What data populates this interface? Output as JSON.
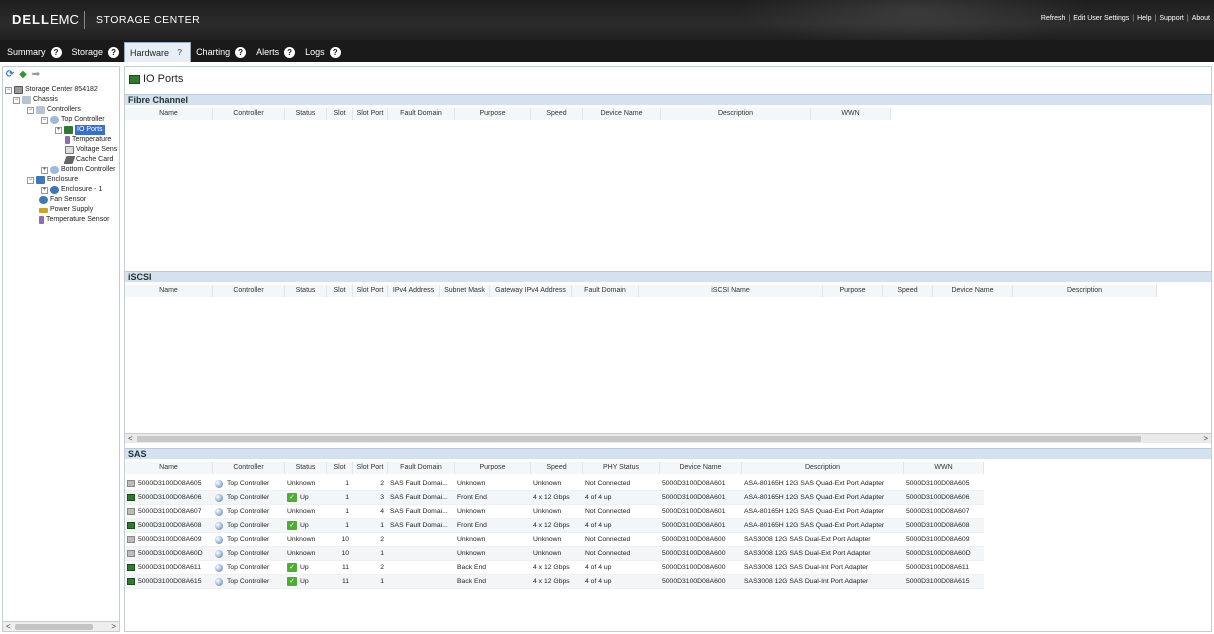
{
  "header": {
    "logo_dell": "DELL",
    "logo_emc": "EMC",
    "product": "STORAGE CENTER",
    "links": [
      "Refresh",
      "Edit User Settings",
      "Help",
      "Support",
      "About"
    ]
  },
  "tabs": [
    {
      "label": "Summary",
      "active": false
    },
    {
      "label": "Storage",
      "active": false
    },
    {
      "label": "Hardware",
      "active": true
    },
    {
      "label": "Charting",
      "active": false
    },
    {
      "label": "Alerts",
      "active": false
    },
    {
      "label": "Logs",
      "active": false
    }
  ],
  "tree": {
    "nodes": [
      {
        "label": "Storage Center 854182",
        "icon": "storage-center-icon"
      },
      {
        "label": "Chassis",
        "icon": "chassis-icon"
      },
      {
        "label": "Controllers",
        "icon": "controllers-icon"
      },
      {
        "label": "Top Controller",
        "icon": "controller-icon"
      },
      {
        "label": "IO Ports",
        "icon": "io-ports-icon",
        "selected": true
      },
      {
        "label": "Temperature",
        "icon": "temperature-icon"
      },
      {
        "label": "Voltage Sens",
        "icon": "voltage-icon"
      },
      {
        "label": "Cache Card",
        "icon": "cache-card-icon"
      },
      {
        "label": "Bottom Controller",
        "icon": "controller-icon"
      },
      {
        "label": "Enclosure",
        "icon": "enclosure-icon"
      },
      {
        "label": "Enclosure - 1",
        "icon": "enclosure-icon"
      },
      {
        "label": "Fan Sensor",
        "icon": "fan-icon"
      },
      {
        "label": "Power Supply",
        "icon": "power-icon"
      },
      {
        "label": "Temperature Sensor",
        "icon": "temperature-icon"
      }
    ]
  },
  "content": {
    "title": "IO Ports",
    "fibre_channel": {
      "title": "Fibre Channel",
      "columns": [
        "Name",
        "Controller",
        "Status",
        "Slot",
        "Slot Port",
        "Fault Domain",
        "Purpose",
        "Speed",
        "Device Name",
        "Description",
        "WWN"
      ]
    },
    "iscsi": {
      "title": "iSCSI",
      "columns": [
        "Name",
        "Controller",
        "Status",
        "Slot",
        "Slot Port",
        "IPv4 Address",
        "Subnet Mask",
        "Gateway IPv4 Address",
        "Fault Domain",
        "iSCSI Name",
        "Purpose",
        "Speed",
        "Device Name",
        "Description"
      ]
    },
    "sas": {
      "title": "SAS",
      "columns": [
        "Name",
        "Controller",
        "Status",
        "Slot",
        "Slot Port",
        "Fault Domain",
        "Purpose",
        "Speed",
        "PHY Status",
        "Device Name",
        "Description",
        "WWN"
      ],
      "rows": [
        {
          "name": "5000D3100D08A605",
          "up": false,
          "controller": "Top Controller",
          "status": "Unknown",
          "slot": "1",
          "slot_port": "2",
          "fault_domain": "SAS Fault Domai...",
          "purpose": "Unknown",
          "speed": "Unknown",
          "phy": "Not Connected",
          "device": "5000D3100D08A601",
          "description": "ASA-80165H 12G SAS Quad-Ext Port Adapter",
          "wwn": "5000D3100D08A605"
        },
        {
          "name": "5000D3100D08A606",
          "up": true,
          "controller": "Top Controller",
          "status": "Up",
          "slot": "1",
          "slot_port": "3",
          "fault_domain": "SAS Fault Domai...",
          "purpose": "Front End",
          "speed": "4 x 12 Gbps",
          "phy": "4 of 4 up",
          "device": "5000D3100D08A601",
          "description": "ASA-80165H 12G SAS Quad-Ext Port Adapter",
          "wwn": "5000D3100D08A606"
        },
        {
          "name": "5000D3100D08A607",
          "up": false,
          "controller": "Top Controller",
          "status": "Unknown",
          "slot": "1",
          "slot_port": "4",
          "fault_domain": "SAS Fault Domai...",
          "purpose": "Unknown",
          "speed": "Unknown",
          "phy": "Not Connected",
          "device": "5000D3100D08A601",
          "description": "ASA-80165H 12G SAS Quad-Ext Port Adapter",
          "wwn": "5000D3100D08A607"
        },
        {
          "name": "5000D3100D08A608",
          "up": true,
          "controller": "Top Controller",
          "status": "Up",
          "slot": "1",
          "slot_port": "1",
          "fault_domain": "SAS Fault Domai...",
          "purpose": "Front End",
          "speed": "4 x 12 Gbps",
          "phy": "4 of 4 up",
          "device": "5000D3100D08A601",
          "description": "ASA-80165H 12G SAS Quad-Ext Port Adapter",
          "wwn": "5000D3100D08A608"
        },
        {
          "name": "5000D3100D08A609",
          "up": false,
          "controller": "Top Controller",
          "status": "Unknown",
          "slot": "10",
          "slot_port": "2",
          "fault_domain": "",
          "purpose": "Unknown",
          "speed": "Unknown",
          "phy": "Not Connected",
          "device": "5000D3100D08A600",
          "description": "SAS3008 12G SAS Dual-Ext Port Adapter",
          "wwn": "5000D3100D08A609"
        },
        {
          "name": "5000D3100D08A60D",
          "up": false,
          "controller": "Top Controller",
          "status": "Unknown",
          "slot": "10",
          "slot_port": "1",
          "fault_domain": "",
          "purpose": "Unknown",
          "speed": "Unknown",
          "phy": "Not Connected",
          "device": "5000D3100D08A600",
          "description": "SAS3008 12G SAS Dual-Ext Port Adapter",
          "wwn": "5000D3100D08A60D"
        },
        {
          "name": "5000D3100D08A611",
          "up": true,
          "controller": "Top Controller",
          "status": "Up",
          "slot": "11",
          "slot_port": "2",
          "fault_domain": "",
          "purpose": "Back End",
          "speed": "4 x 12 Gbps",
          "phy": "4 of 4 up",
          "device": "5000D3100D08A600",
          "description": "SAS3008 12G SAS Dual-Int Port Adapter",
          "wwn": "5000D3100D08A611"
        },
        {
          "name": "5000D3100D08A615",
          "up": true,
          "controller": "Top Controller",
          "status": "Up",
          "slot": "11",
          "slot_port": "1",
          "fault_domain": "",
          "purpose": "Back End",
          "speed": "4 x 12 Gbps",
          "phy": "4 of 4 up",
          "device": "5000D3100D08A600",
          "description": "SAS3008 12G SAS Dual-Int Port Adapter",
          "wwn": "5000D3100D08A615"
        }
      ]
    }
  },
  "colors": {
    "selected": "#3a6fcf",
    "status_up": "#4caf2f",
    "section_header": "#d5e1ef"
  }
}
